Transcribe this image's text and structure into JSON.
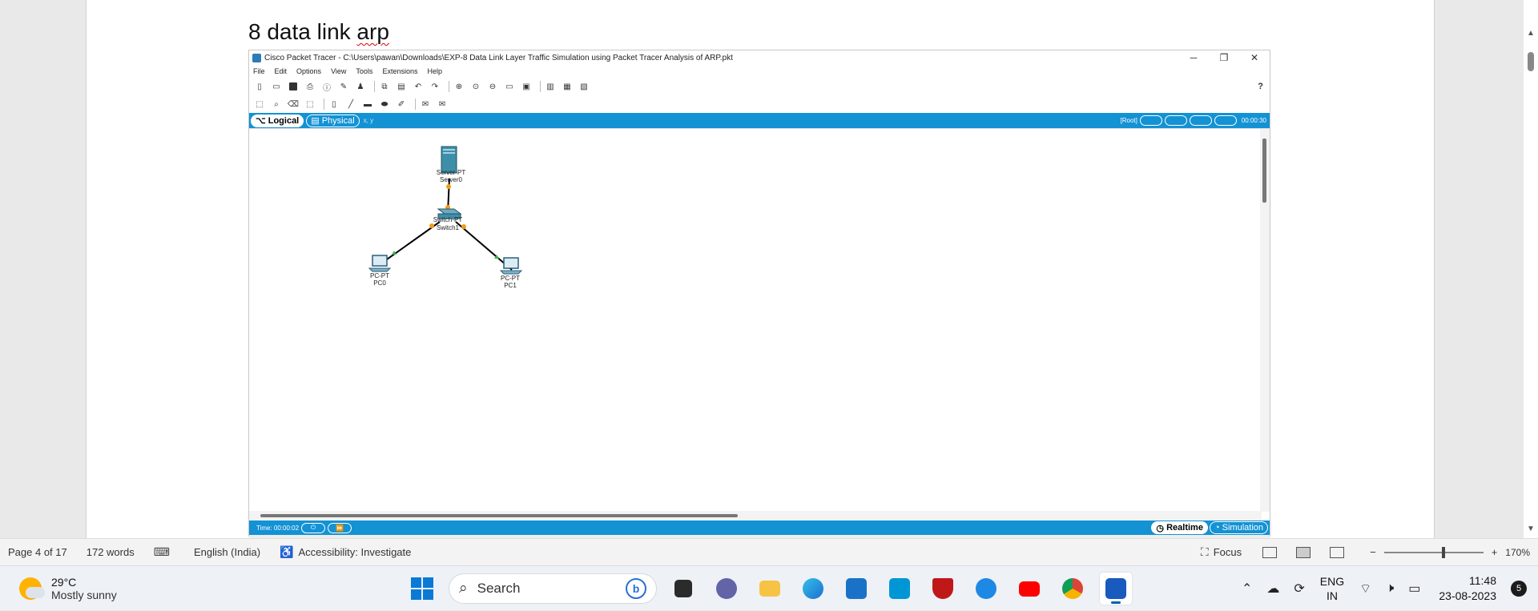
{
  "document": {
    "heading_prefix": "8 data link ",
    "heading_misspelled": "arp"
  },
  "packet_tracer": {
    "title": "Cisco Packet Tracer - C:\\Users\\pawan\\Downloads\\EXP-8 Data Link Layer Traffic Simulation using Packet Tracer Analysis of ARP.pkt",
    "menu": [
      "File",
      "Edit",
      "Options",
      "View",
      "Tools",
      "Extensions",
      "Help"
    ],
    "help_label": "?",
    "tabs": {
      "logical": "Logical",
      "physical": "Physical",
      "coords": "x, y"
    },
    "root_label": "[Root]",
    "timer": "00:00:30",
    "time_label": "Time: 00:00:02",
    "modes": {
      "realtime": "Realtime",
      "simulation": "Simulation"
    },
    "devices": {
      "server": {
        "type": "Server-PT",
        "name": "Server0"
      },
      "switch": {
        "type": "Switch-PT",
        "name": "Switch1"
      },
      "pc0": {
        "type": "PC-PT",
        "name": "PC0"
      },
      "pc1": {
        "type": "PC-PT",
        "name": "PC1"
      }
    }
  },
  "statusbar": {
    "page": "Page 4 of 17",
    "words": "172 words",
    "language": "English (India)",
    "accessibility": "Accessibility: Investigate",
    "focus": "Focus",
    "zoom": "170%"
  },
  "taskbar": {
    "weather_temp": "29°C",
    "weather_desc": "Mostly sunny",
    "search_placeholder": "Search",
    "lang_line1": "ENG",
    "lang_line2": "IN",
    "time": "11:48",
    "date": "23-08-2023",
    "notifications": "5"
  }
}
